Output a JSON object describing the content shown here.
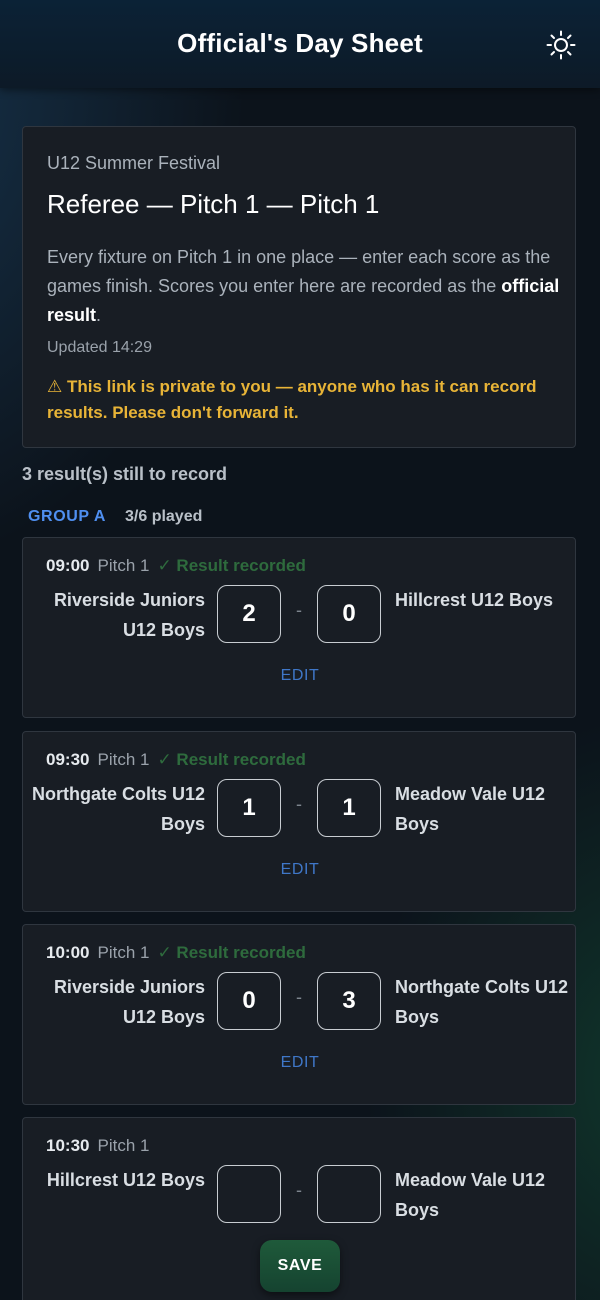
{
  "header": {
    "title": "Official's Day Sheet",
    "theme_icon": "sun-icon"
  },
  "intro": {
    "event": "U12 Summer Festival",
    "heading": "Referee — Pitch 1 — Pitch 1",
    "description_prefix": "Every fixture on Pitch 1 in one place — enter each score as the games finish. Scores you enter here are recorded as the ",
    "description_bold": "official result",
    "description_suffix": ".",
    "updated": "Updated 14:29",
    "warning": "⚠ This link is private to you — anyone who has it can record results. Please don't forward it.",
    "warning_color": "#e8b437"
  },
  "pending": "3 result(s) still to record",
  "group": {
    "name": "GROUP A",
    "played": "3/6 played",
    "accent": "#4f8ff0"
  },
  "fixtures": [
    {
      "time": "09:00",
      "pitch": "Pitch 1",
      "status": "✓ Result recorded",
      "home": "Riverside Juniors U12 Boys",
      "away": "Hillcrest U12 Boys",
      "home_score": "2",
      "away_score": "0",
      "dash": "-",
      "action": "EDIT"
    },
    {
      "time": "09:30",
      "pitch": "Pitch 1",
      "status": "✓ Result recorded",
      "home": "Northgate Colts U12 Boys",
      "away": "Meadow Vale U12 Boys",
      "home_score": "1",
      "away_score": "1",
      "dash": "-",
      "action": "EDIT"
    },
    {
      "time": "10:00",
      "pitch": "Pitch 1",
      "status": "✓ Result recorded",
      "home": "Riverside Juniors U12 Boys",
      "away": "Northgate Colts U12 Boys",
      "home_score": "0",
      "away_score": "3",
      "dash": "-",
      "action": "EDIT"
    },
    {
      "time": "10:30",
      "pitch": "Pitch 1",
      "status": "",
      "home": "Hillcrest U12 Boys",
      "away": "Meadow Vale U12 Boys",
      "home_score": "",
      "away_score": "",
      "dash": "-",
      "action": "SAVE"
    }
  ],
  "colors": {
    "recorded": "#2e6b3d",
    "edit": "#3f77c8",
    "save_bg": "#1f5a3a"
  }
}
